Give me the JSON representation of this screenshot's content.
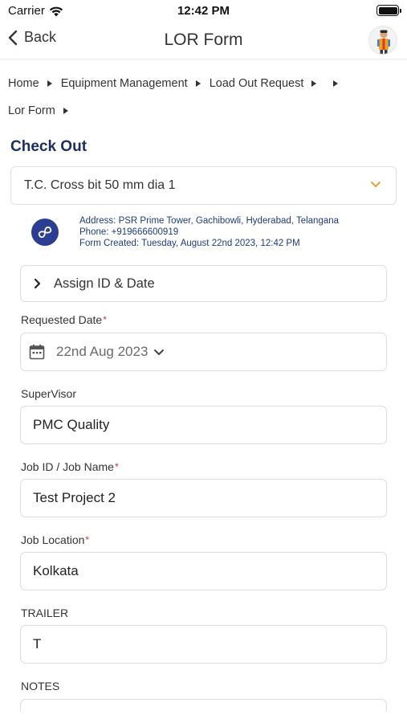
{
  "status": {
    "carrier": "Carrier",
    "time": "12:42 PM"
  },
  "nav": {
    "back_label": "Back",
    "title": "LOR Form",
    "avatar_icon": "avatar-figure-icon"
  },
  "breadcrumb": {
    "items": [
      "Home",
      "Equipment Management",
      "Load Out Request",
      "Lor Form"
    ]
  },
  "section_title": "Check Out",
  "equipment_select": {
    "value": "T.C. Cross bit 50 mm dia 1",
    "chevron_color": "#e0a43a"
  },
  "company": {
    "address": "Address: PSR Prime Tower, Gachibowli, Hyderabad, Telangana",
    "phone": "Phone: +919666600919",
    "created": "Form Created: Tuesday, August 22nd 2023, 12:42 PM"
  },
  "accordion": {
    "label": "Assign ID & Date"
  },
  "form": {
    "requested_date": {
      "label": "Requested Date",
      "required": "*",
      "value": "22nd Aug 2023"
    },
    "supervisor": {
      "label": "SuperVisor",
      "value": "PMC Quality"
    },
    "job": {
      "label": "Job ID / Job Name",
      "required": "*",
      "value": "Test Project 2"
    },
    "location": {
      "label": "Job Location",
      "required": "*",
      "value": "Kolkata"
    },
    "trailer": {
      "label": "TRAILER",
      "value": "T"
    },
    "notes": {
      "label": "NOTES",
      "value": ""
    }
  },
  "colors": {
    "title_navy": "#1c2e5e",
    "logo_blue": "#2c3e93",
    "required_red": "#e0302a"
  }
}
